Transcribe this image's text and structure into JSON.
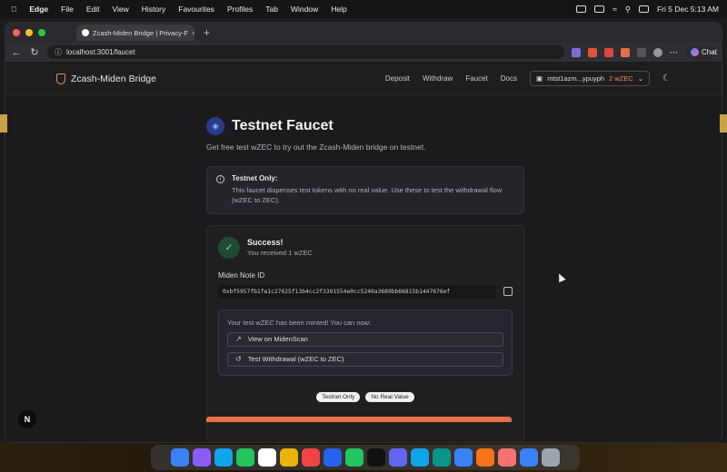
{
  "menubar": {
    "app": "Edge",
    "items": [
      "File",
      "Edit",
      "View",
      "History",
      "Favourites",
      "Profiles",
      "Tab",
      "Window",
      "Help"
    ],
    "datetime": "Fri 5 Dec  5:13 AM"
  },
  "browser": {
    "tab_title": "Zcash-Miden Bridge | Privacy-F",
    "url": "localhost:3001/faucet",
    "copilot_label": "Chat"
  },
  "app": {
    "brand": "Zcash-Miden Bridge",
    "nav": [
      "Deposit",
      "Withdraw",
      "Faucet",
      "Docs"
    ],
    "wallet_address": "mtst1azm...ypuyph",
    "wallet_balance": "2 wZEC"
  },
  "faucet": {
    "title": "Testnet Faucet",
    "subtitle": "Get free test wZEC to try out the Zcash-Miden bridge on testnet.",
    "notice_title": "Testnet Only:",
    "notice_text": "This faucet dispenses test tokens with no real value. Use these to test the withdrawal flow (wZEC to ZEC).",
    "success_title": "Success!",
    "success_text": "You received 1 wZEC",
    "note_label": "Miden Note ID",
    "note_id": "0xbf5957fb1fe1c27625f13b4cc2f3391554e0cc5240a3689bb66815b1447676ef",
    "minted_text": "Your test wZEC has been minted! You can now:",
    "btn_scan": "View on MidenScan",
    "btn_withdraw": "Test Withdrawal (wZEC to ZEC)",
    "pill_testnet": "Testnet Only",
    "pill_noval": "No Real Value"
  },
  "colors": {
    "accent": "#f08a5d",
    "success": "#6fe09a"
  },
  "dock_badge": "N"
}
